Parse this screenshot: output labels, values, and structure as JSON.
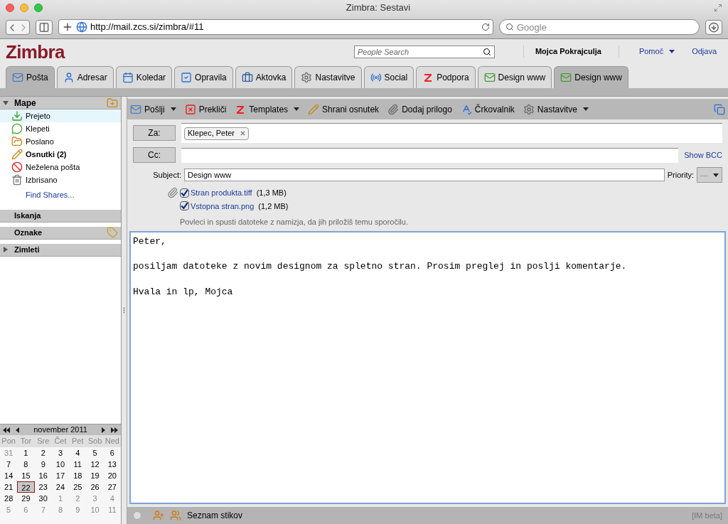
{
  "window": {
    "title": "Zimbra: Sestavi"
  },
  "browser": {
    "url": "http://mail.zcs.si/zimbra/#11",
    "search_placeholder": "Google"
  },
  "header": {
    "logo": "Zimbra",
    "people_search_placeholder": "People Search",
    "user": "Mojca Pokrajculja",
    "help": "Pomoč",
    "logout": "Odjava"
  },
  "tabs": [
    {
      "label": "Pošta",
      "kind": "mail",
      "selected": true
    },
    {
      "label": "Adresar",
      "kind": "contact",
      "selected": false
    },
    {
      "label": "Koledar",
      "kind": "calendar",
      "selected": false
    },
    {
      "label": "Opravila",
      "kind": "task",
      "selected": false
    },
    {
      "label": "Aktovka",
      "kind": "briefcase",
      "selected": false
    },
    {
      "label": "Nastavitve",
      "kind": "gear",
      "selected": false
    },
    {
      "label": "Social",
      "kind": "social",
      "selected": false
    },
    {
      "label": "Podpora",
      "kind": "zimbra",
      "selected": false
    },
    {
      "label": "Design www",
      "kind": "compose",
      "selected": false
    },
    {
      "label": "Design www",
      "kind": "compose",
      "selected": true
    }
  ],
  "sidebar": {
    "folders_header": "Mape",
    "folders": [
      {
        "label": "Prejeto",
        "kind": "inbox",
        "bold": false,
        "selected": true
      },
      {
        "label": "Klepeti",
        "kind": "chat",
        "bold": false,
        "selected": false
      },
      {
        "label": "Poslano",
        "kind": "sent",
        "bold": false,
        "selected": false
      },
      {
        "label": "Osnutki (2)",
        "kind": "drafts",
        "bold": true,
        "selected": false
      },
      {
        "label": "Neželena pošta",
        "kind": "junk",
        "bold": false,
        "selected": false
      },
      {
        "label": "Izbrisano",
        "kind": "trash",
        "bold": false,
        "selected": false
      }
    ],
    "find_shares": "Find Shares...",
    "sections": [
      {
        "label": "Iskanja",
        "expander": false,
        "add_icon": false
      },
      {
        "label": "Oznake",
        "expander": false,
        "add_icon": true
      },
      {
        "label": "Zimleti",
        "expander": true,
        "add_icon": false
      }
    ]
  },
  "calendar": {
    "month": "november 2011",
    "weekdays": [
      "Pon",
      "Tor",
      "Sre",
      "Čet",
      "Pet",
      "Sob",
      "Ned"
    ],
    "weeks": [
      [
        {
          "d": "31",
          "muted": true,
          "selected": false
        },
        {
          "d": "1",
          "muted": false,
          "selected": false
        },
        {
          "d": "2",
          "muted": false,
          "selected": false
        },
        {
          "d": "3",
          "muted": false,
          "selected": false
        },
        {
          "d": "4",
          "muted": false,
          "selected": false
        },
        {
          "d": "5",
          "muted": false,
          "selected": false
        },
        {
          "d": "6",
          "muted": false,
          "selected": false
        }
      ],
      [
        {
          "d": "7",
          "muted": false,
          "selected": false
        },
        {
          "d": "8",
          "muted": false,
          "selected": false
        },
        {
          "d": "9",
          "muted": false,
          "selected": false
        },
        {
          "d": "10",
          "muted": false,
          "selected": false
        },
        {
          "d": "11",
          "muted": false,
          "selected": false
        },
        {
          "d": "12",
          "muted": false,
          "selected": false
        },
        {
          "d": "13",
          "muted": false,
          "selected": false
        }
      ],
      [
        {
          "d": "14",
          "muted": false,
          "selected": false
        },
        {
          "d": "15",
          "muted": false,
          "selected": false
        },
        {
          "d": "16",
          "muted": false,
          "selected": false
        },
        {
          "d": "17",
          "muted": false,
          "selected": false
        },
        {
          "d": "18",
          "muted": false,
          "selected": false
        },
        {
          "d": "19",
          "muted": false,
          "selected": false
        },
        {
          "d": "20",
          "muted": false,
          "selected": false
        }
      ],
      [
        {
          "d": "21",
          "muted": false,
          "selected": false
        },
        {
          "d": "22",
          "muted": false,
          "selected": true
        },
        {
          "d": "23",
          "muted": false,
          "selected": false
        },
        {
          "d": "24",
          "muted": false,
          "selected": false
        },
        {
          "d": "25",
          "muted": false,
          "selected": false
        },
        {
          "d": "26",
          "muted": false,
          "selected": false
        },
        {
          "d": "27",
          "muted": false,
          "selected": false
        }
      ],
      [
        {
          "d": "28",
          "muted": false,
          "selected": false
        },
        {
          "d": "29",
          "muted": false,
          "selected": false
        },
        {
          "d": "30",
          "muted": false,
          "selected": false
        },
        {
          "d": "1",
          "muted": true,
          "selected": false
        },
        {
          "d": "2",
          "muted": true,
          "selected": false
        },
        {
          "d": "3",
          "muted": true,
          "selected": false
        },
        {
          "d": "4",
          "muted": true,
          "selected": false
        }
      ],
      [
        {
          "d": "5",
          "muted": true,
          "selected": false
        },
        {
          "d": "6",
          "muted": true,
          "selected": false
        },
        {
          "d": "7",
          "muted": true,
          "selected": false
        },
        {
          "d": "8",
          "muted": true,
          "selected": false
        },
        {
          "d": "9",
          "muted": true,
          "selected": false
        },
        {
          "d": "10",
          "muted": true,
          "selected": false
        },
        {
          "d": "11",
          "muted": true,
          "selected": false
        }
      ]
    ]
  },
  "toolbar": [
    {
      "label": "Pošlji",
      "kind": "mail",
      "dropdown": true
    },
    {
      "label": "Prekliči",
      "kind": "cancel",
      "dropdown": false
    },
    {
      "label": "Templates",
      "kind": "zimbra",
      "dropdown": true
    },
    {
      "label": "Shrani osnutek",
      "kind": "drafts",
      "dropdown": false
    },
    {
      "label": "Dodaj prilogo",
      "kind": "clip",
      "dropdown": false
    },
    {
      "label": "Črkovalnik",
      "kind": "spell",
      "dropdown": false
    },
    {
      "label": "Nastavitve",
      "kind": "gear",
      "dropdown": true
    }
  ],
  "compose": {
    "to_label": "Za:",
    "to": [
      "Klepec, Peter"
    ],
    "cc_label": "Cc:",
    "show_bcc": "Show BCC",
    "subject_label": "Subject:",
    "subject": "Design www",
    "priority_label": "Priority:",
    "priority": "—",
    "attachments": [
      {
        "name": "Stran produkta.tiff",
        "size": "(1,3 MB)",
        "checked": true
      },
      {
        "name": "Vstopna stran.png",
        "size": "(1,2 MB)",
        "checked": true
      }
    ],
    "drop_hint": "Povleci in spusti datoteke z namizja, da jih priložiš temu sporočilu.",
    "body": [
      "Peter,",
      "posiljam datoteke z novim designom za spletno stran. Prosim preglej in poslji komentarje.",
      "Hvala in lp, Mojca"
    ]
  },
  "status_bar": {
    "contacts": "Seznam stikov",
    "im": "[IM beta]"
  }
}
